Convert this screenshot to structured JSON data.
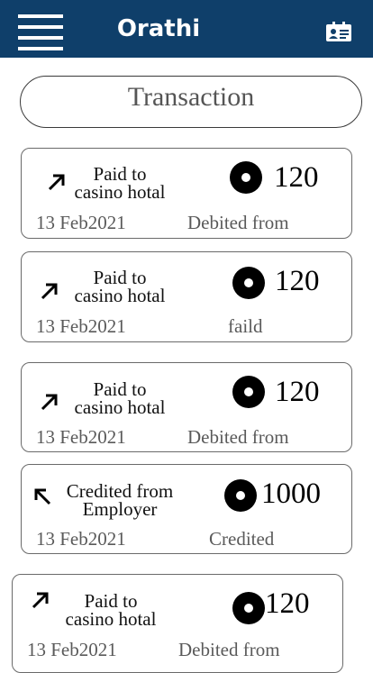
{
  "header": {
    "app_title": "Orathi",
    "menu_icon": "hamburger-menu-icon",
    "profile_icon": "id-card-icon",
    "bg_color": "#0f3f6a"
  },
  "section_title": "Transaction",
  "transactions": [
    {
      "direction": "outgoing",
      "line1": "Paid to",
      "line2": "casino hotal",
      "amount": "120",
      "date": "13 Feb2021",
      "status": "Debited from"
    },
    {
      "direction": "outgoing",
      "line1": "Paid to",
      "line2": "casino hotal",
      "amount": "120",
      "date": "13 Feb2021",
      "status": "faild"
    },
    {
      "direction": "outgoing",
      "line1": "Paid to",
      "line2": "casino hotal",
      "amount": "120",
      "date": "13 Feb2021",
      "status": "Debited from"
    },
    {
      "direction": "incoming",
      "line1": "Credited from",
      "line2": "Employer",
      "amount": "1000",
      "date": "13 Feb2021",
      "status": "Credited"
    },
    {
      "direction": "outgoing",
      "line1": "Paid to",
      "line2": "casino hotal",
      "amount": "120",
      "date": "13 Feb2021",
      "status": "Debited from"
    }
  ]
}
